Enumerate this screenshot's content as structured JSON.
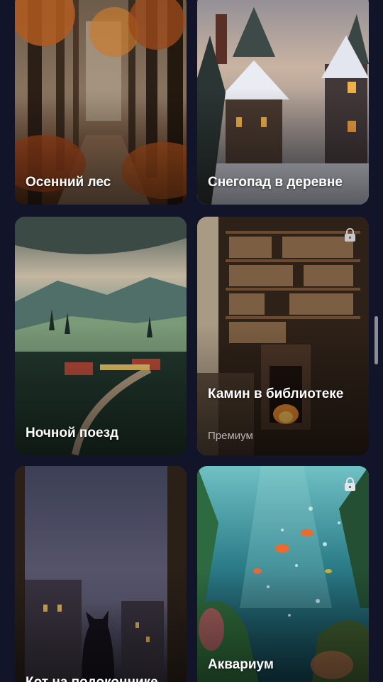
{
  "scenes": [
    {
      "title": "Осенний лес",
      "subtitle": "",
      "locked": false
    },
    {
      "title": "Снегопад в деревне",
      "subtitle": "",
      "locked": false
    },
    {
      "title": "Ночной поезд",
      "subtitle": "",
      "locked": false
    },
    {
      "title": "Камин в библиотеке",
      "subtitle": "Премиум",
      "locked": true
    },
    {
      "title": "Кот на подоконнике",
      "subtitle": "",
      "locked": false
    },
    {
      "title": "Аквариум",
      "subtitle": "",
      "locked": true
    }
  ],
  "icons": {
    "lock": "lock-icon"
  },
  "colors": {
    "background": "#12142a",
    "subtitle": "#b9b4b0"
  }
}
